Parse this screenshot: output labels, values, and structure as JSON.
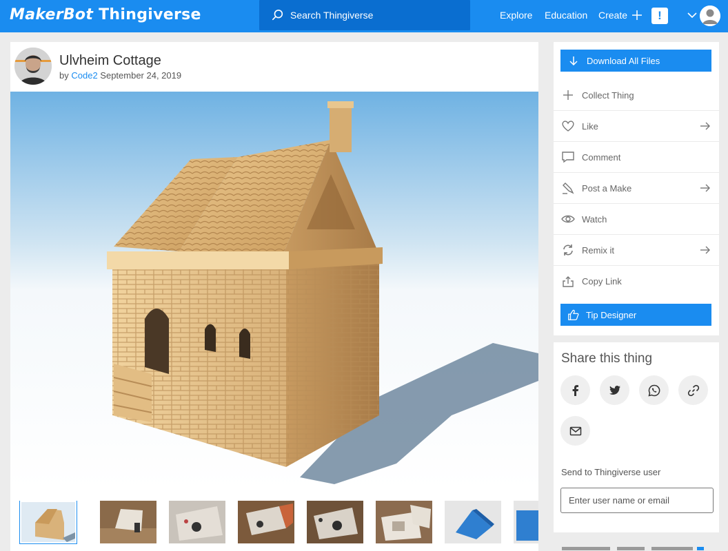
{
  "header": {
    "logo_maker": "MakerBot",
    "logo_thingiverse": "Thingiverse",
    "search_placeholder": "Search Thingiverse",
    "nav": {
      "explore": "Explore",
      "education": "Education",
      "create": "Create"
    },
    "alert_glyph": "!",
    "brand_color": "#1a8cf0"
  },
  "thing": {
    "title": "Ulvheim Cottage",
    "by_prefix": "by",
    "author": "Code2",
    "date": "September 24, 2019"
  },
  "actions": {
    "download": "Download All Files",
    "items": [
      {
        "label": "Collect Thing",
        "icon": "plus-icon"
      },
      {
        "label": "Like",
        "icon": "heart-icon"
      },
      {
        "label": "Comment",
        "icon": "comment-icon"
      },
      {
        "label": "Post a Make",
        "icon": "pencil-icon"
      },
      {
        "label": "Watch",
        "icon": "eye-icon"
      },
      {
        "label": "Remix it",
        "icon": "remix-icon"
      },
      {
        "label": "Copy Link",
        "icon": "share-icon"
      }
    ],
    "tip": "Tip Designer"
  },
  "share": {
    "title": "Share this thing",
    "networks": [
      "facebook-icon",
      "twitter-icon",
      "whatsapp-icon",
      "link-icon",
      "email-icon"
    ],
    "send_label": "Send to Thingiverse user",
    "send_placeholder": "Enter user name or email"
  }
}
